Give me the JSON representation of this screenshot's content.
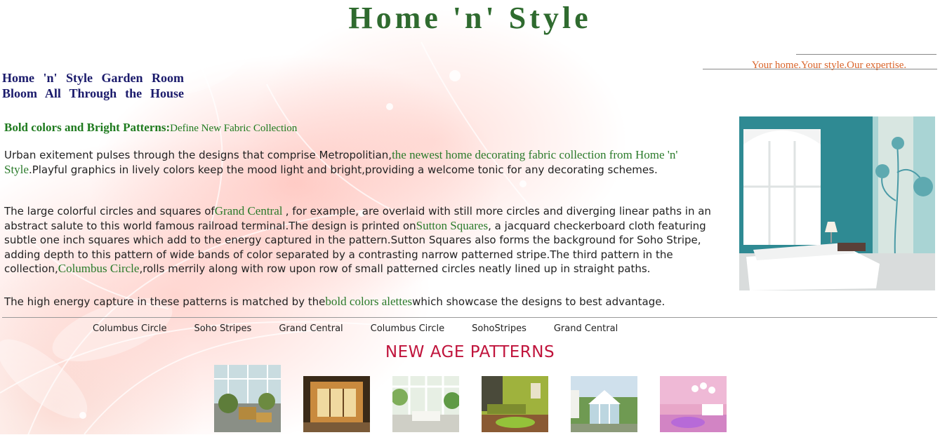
{
  "header": {
    "title": "Home 'n' Style",
    "tagline": "Your home.Your style.Our expertise."
  },
  "promo": {
    "line1": "Home 'n' Style Garden Room",
    "line2": "Bloom All Through the House"
  },
  "section": {
    "title_bold": "Bold colors and Bright Patterns:",
    "title_rest": "Define New Fabric Collection"
  },
  "paragraph1": {
    "a": "Urban exitement pulses through the designs that comprise Metropolitian,",
    "b": "the newest home decorating fabric collection from Home 'n' Style",
    "c": ".Playful graphics in lively colors keep the mood light and bright,providing a welcome tonic for any decorating schemes."
  },
  "paragraph2": {
    "a": "The large colorful circles and squares of",
    "b": "Grand Central ",
    "c": ", for example, are overlaid with still more circles and diverging linear paths in an abstract salute to this world famous railroad terminal.The design is printed on",
    "d": "Sutton Squares",
    "e": ", a jacquard checkerboard cloth featuring subtle one inch squares which add to the energy captured in the pattern.Sutton Squares also forms the background for Soho Stripe, adding depth to this pattern of wide bands of color separated by a contrasting narrow patterned stripe.The third pattern in the collection,",
    "f": "Columbus Circle",
    "g": ",rolls merrily along with row upon row of small patterned circles neatly lined up in straight paths."
  },
  "paragraph3": {
    "a": "The high energy capture in these patterns is matched by the",
    "b": "bold colors alettes",
    "c": "which showcase the designs to best advantage."
  },
  "nav": {
    "items": [
      "Columbus Circle",
      "Soho Stripes",
      "Grand Central",
      "Columbus Circle",
      "SohoStripes",
      "Grand Central"
    ]
  },
  "gallery": {
    "heading": "NEW AGE PATTERNS",
    "thumbnails": [
      "conservatory",
      "wooden-garden-room",
      "white-sunroom",
      "green-living-room",
      "glass-garden-house",
      "pink-bedroom"
    ]
  },
  "colors": {
    "title_green": "#2f6b2f",
    "link_green": "#2a7a2a",
    "tagline_orange": "#d9642a",
    "promo_navy": "#1a1a6b",
    "heading_red": "#c0143c"
  }
}
